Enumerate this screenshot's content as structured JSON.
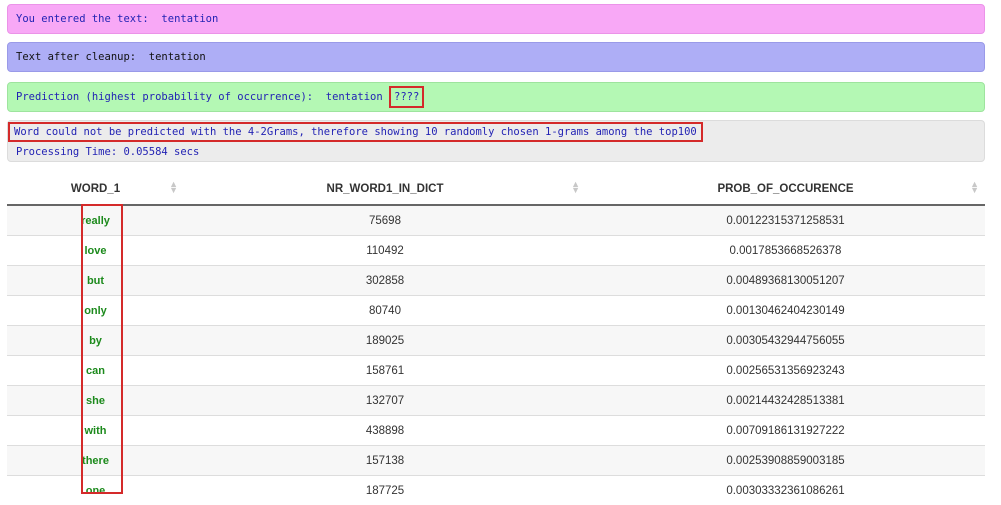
{
  "entered": {
    "label": "You entered the text:",
    "value": "tentation"
  },
  "cleanup": {
    "label": "Text after cleanup:",
    "value": "tentation"
  },
  "prediction": {
    "label": "Prediction (highest probability of occurrence):",
    "value": "tentation",
    "predicted": "????"
  },
  "note": {
    "message": "Word could not be predicted with the 4-2Grams, therefore showing 10 randomly chosen 1-grams among the top100",
    "processing": "Processing Time: 0.05584 secs"
  },
  "table": {
    "headers": [
      "WORD_1",
      "NR_WORD1_IN_DICT",
      "PROB_OF_OCCURENCE"
    ],
    "rows": [
      [
        "really",
        "75698",
        "0.00122315371258531"
      ],
      [
        "love",
        "110492",
        "0.0017853668526378"
      ],
      [
        "but",
        "302858",
        "0.00489368130051207"
      ],
      [
        "only",
        "80740",
        "0.00130462404230149"
      ],
      [
        "by",
        "189025",
        "0.00305432944756055"
      ],
      [
        "can",
        "158761",
        "0.00256531356923243"
      ],
      [
        "she",
        "132707",
        "0.00214432428513381"
      ],
      [
        "with",
        "438898",
        "0.00709186131927222"
      ],
      [
        "there",
        "157138",
        "0.00253908859003185"
      ],
      [
        "one",
        "187725",
        "0.00303332361086261"
      ]
    ]
  },
  "colors": {
    "entered_bg": "#f8a8f6",
    "cleanup_bg": "#aeaef6",
    "prediction_bg": "#b4f8b4",
    "note_bg": "#ececec",
    "highlight": "#d42a2a",
    "word_text": "#1c8a1c"
  }
}
